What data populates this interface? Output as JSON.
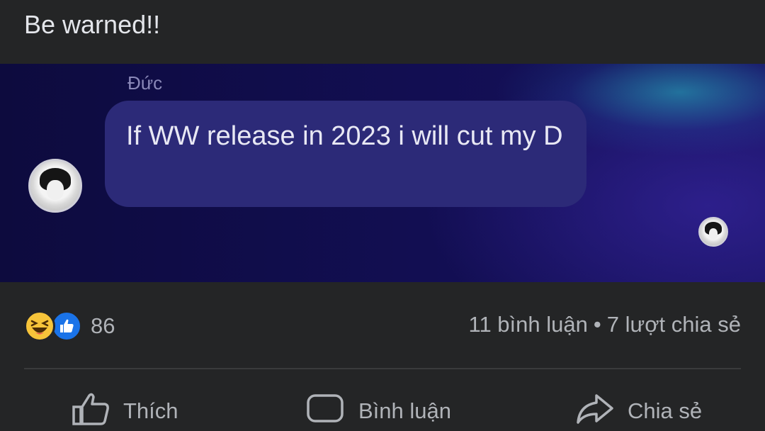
{
  "post": {
    "text": "Be warned!!"
  },
  "image": {
    "sender_name": "Đức",
    "message": "If WW release in 2023 i will cut my D"
  },
  "reactions": {
    "count": "86",
    "icons": [
      "haha-icon",
      "like-icon"
    ]
  },
  "stats": {
    "comments": "11 bình luận",
    "separator": "•",
    "shares": "7 lượt chia sẻ"
  },
  "actions": {
    "like": "Thích",
    "comment": "Bình luận",
    "share": "Chia sẻ"
  },
  "colors": {
    "background": "#242526",
    "bubble": "#2c2a78",
    "like_blue": "#1a73e8",
    "haha_yellow": "#f7c43a"
  }
}
